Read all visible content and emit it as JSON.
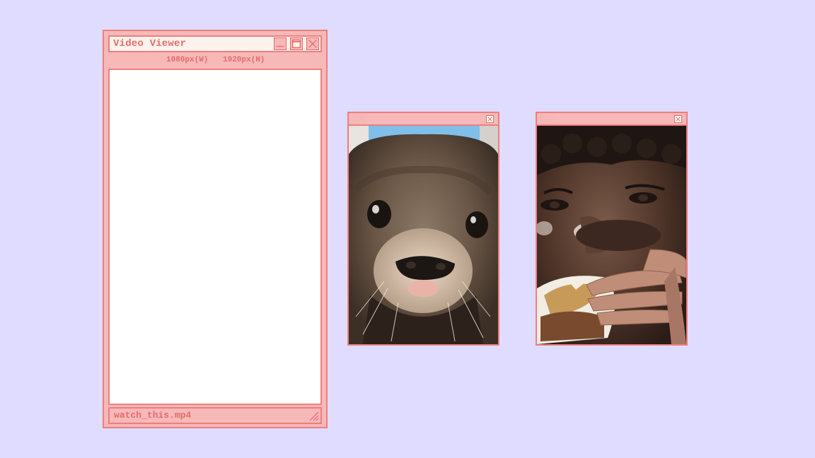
{
  "viewer": {
    "title": "Video Viewer",
    "width_label": "1080px(W)",
    "height_label": "1920px(H)",
    "filename": "watch_this.mp4",
    "buttons": [
      "minimize-icon",
      "maximize-icon",
      "close-icon"
    ]
  },
  "photos": [
    {
      "title": "✧✧✧",
      "subject": "otter close-up"
    },
    {
      "title": "✧✧✧",
      "subject": "man eating burger"
    }
  ],
  "colors": {
    "background": "#e0dcff",
    "window_fill": "#f7b8b8",
    "window_border": "#ec7f7f",
    "title_text": "#e56b6b",
    "titlebar_fill": "#fdf3ec"
  }
}
